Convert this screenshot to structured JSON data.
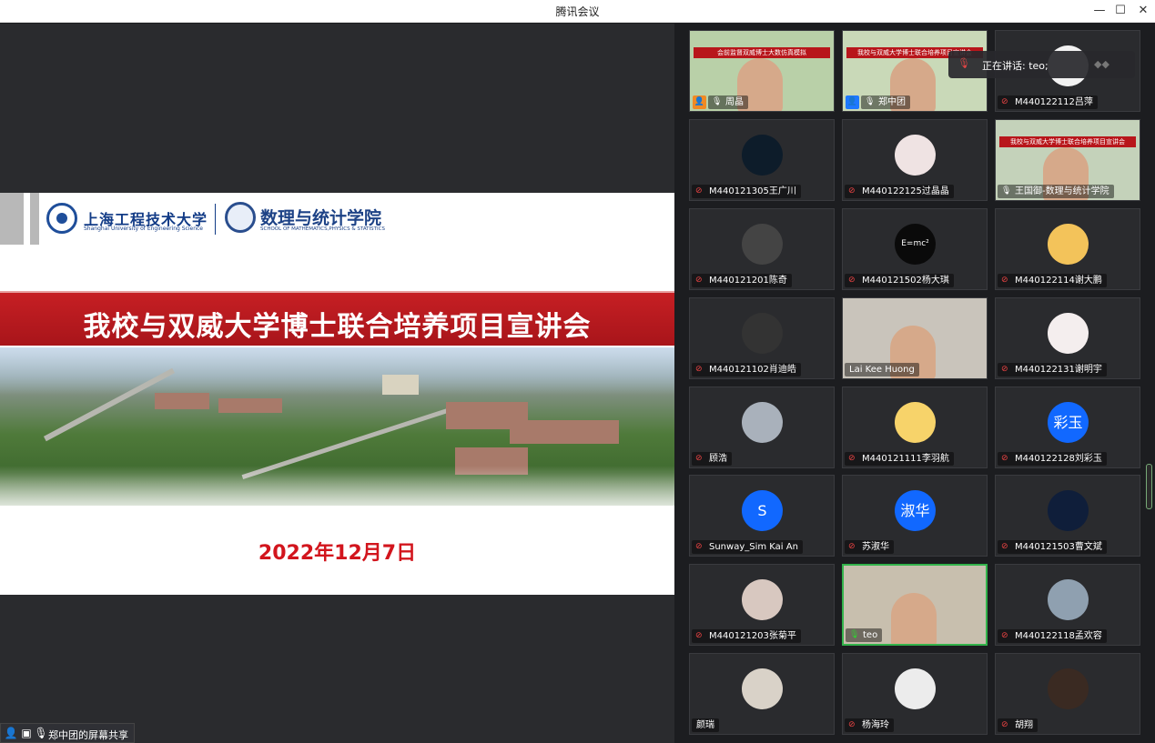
{
  "window": {
    "title": "腾讯会议",
    "min": "—",
    "max": "☐",
    "close": "✕"
  },
  "slide": {
    "uni_cn": "上海工程技术大学",
    "uni_en": "Shanghai University of Engineering Science",
    "school_cn": "数理与统计学院",
    "school_en": "SCHOOL OF MATHEMATICS,PHYSICS & STATISTICS",
    "headline": "我校与双威大学博士联合培养项目宣讲会",
    "date": "2022年12月7日"
  },
  "share_badge": {
    "label": "郑中团的屏幕共享"
  },
  "speaking": {
    "label": "正在讲话: teo;"
  },
  "participants": [
    {
      "name": "周晶",
      "kind": "video",
      "host": "orange",
      "mic": "on",
      "bg": "#b9d0a8",
      "screen": "会前监督双威博士大数仿真模拟"
    },
    {
      "name": "郑中团",
      "kind": "video",
      "host": "blue",
      "mic": "on",
      "bg": "#c9d9b8",
      "screen": "我校与双威大学博士联合培养项目宣讲会"
    },
    {
      "name": "M440122112吕萍",
      "kind": "avatar",
      "mic": "off",
      "bg": "#f2f2f2",
      "text": ""
    },
    {
      "name": "M440121305王广川",
      "kind": "avatar",
      "mic": "off",
      "bg": "#0d1c2a",
      "text": ""
    },
    {
      "name": "M440122125过晶晶",
      "kind": "avatar",
      "mic": "off",
      "bg": "#efe3e3",
      "text": ""
    },
    {
      "name": "王国御-数理与统计学院",
      "kind": "video",
      "mic": "on",
      "bg": "#c4d2ba",
      "screen": "我校与双威大学博士联合培养项目宣讲会"
    },
    {
      "name": "M440121201陈奇",
      "kind": "avatar",
      "mic": "off",
      "bg": "#444",
      "text": ""
    },
    {
      "name": "M440121502杨大琪",
      "kind": "avatar",
      "mic": "off",
      "bg": "#0a0a0a",
      "text": "E=mc²"
    },
    {
      "name": "M440122114谢大鹏",
      "kind": "avatar",
      "mic": "off",
      "bg": "#f3c35a",
      "text": ""
    },
    {
      "name": "M440121102肖迪皓",
      "kind": "avatar",
      "mic": "off",
      "bg": "#333",
      "text": ""
    },
    {
      "name": "Lai Kee Huong",
      "kind": "video",
      "mic": "none",
      "bg": "#c9c4bb",
      "screen": ""
    },
    {
      "name": "M440122131谢明宇",
      "kind": "avatar",
      "mic": "off",
      "bg": "#f4eeee",
      "text": ""
    },
    {
      "name": "顾浩",
      "kind": "avatar",
      "mic": "off",
      "bg": "#a9b1bb",
      "text": ""
    },
    {
      "name": "M440121111李羽航",
      "kind": "avatar",
      "mic": "off",
      "bg": "#f7d36a",
      "text": ""
    },
    {
      "name": "M440122128刘彩玉",
      "kind": "avatar",
      "mic": "off",
      "bg": "#1168ff",
      "text": "彩玉"
    },
    {
      "name": "Sunway_Sim Kai An",
      "kind": "avatar",
      "mic": "off",
      "bg": "#1168ff",
      "text": "S"
    },
    {
      "name": "苏淑华",
      "kind": "avatar",
      "mic": "off",
      "bg": "#1168ff",
      "text": "淑华"
    },
    {
      "name": "M440121503曹文斌",
      "kind": "avatar",
      "mic": "off",
      "bg": "#0f1e3a",
      "text": ""
    },
    {
      "name": "M440121203张菊平",
      "kind": "avatar",
      "mic": "off",
      "bg": "#d8c8c0",
      "text": ""
    },
    {
      "name": "teo",
      "kind": "video",
      "mic": "green",
      "active": true,
      "bg": "#c8bfae",
      "screen": ""
    },
    {
      "name": "M440122118孟欢容",
      "kind": "avatar",
      "mic": "off",
      "bg": "#8fa0b0",
      "text": ""
    },
    {
      "name": "颜瑞",
      "kind": "avatar",
      "mic": "none",
      "bg": "#d9d2c8",
      "text": ""
    },
    {
      "name": "杨海玲",
      "kind": "avatar",
      "mic": "off",
      "bg": "#ececec",
      "text": ""
    },
    {
      "name": "胡翔",
      "kind": "avatar",
      "mic": "off",
      "bg": "#3a2a22",
      "text": ""
    }
  ]
}
